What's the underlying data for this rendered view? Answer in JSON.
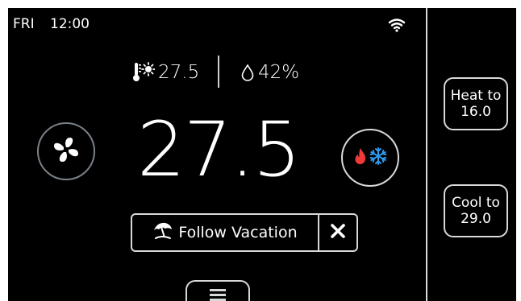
{
  "status_bar": {
    "day": "FRI",
    "time": "12:00",
    "wifi_icon": "wifi-icon"
  },
  "indoor": {
    "temperature_icon": "thermometer-sun-icon",
    "temperature": "27.5",
    "humidity_icon": "droplet-icon",
    "humidity": "42%"
  },
  "main": {
    "fan_icon": "fan-icon",
    "setpoint": "27.5",
    "mode_icons": [
      "flame-icon",
      "snowflake-icon"
    ]
  },
  "vacation": {
    "icon": "beach-umbrella-icon",
    "label": "Follow Vacation",
    "close_icon": "close-icon"
  },
  "menu": {
    "icon": "menu-icon"
  },
  "setpoints": {
    "heat_label": "Heat to",
    "heat_value": "16.0",
    "cool_label": "Cool to",
    "cool_value": "29.0"
  },
  "colors": {
    "background": "#000000",
    "text": "#ffffff",
    "border": "#d9d9d9",
    "fan_border": "#7a8189",
    "heat": "#f03a3a",
    "cool": "#2e9bf0"
  }
}
